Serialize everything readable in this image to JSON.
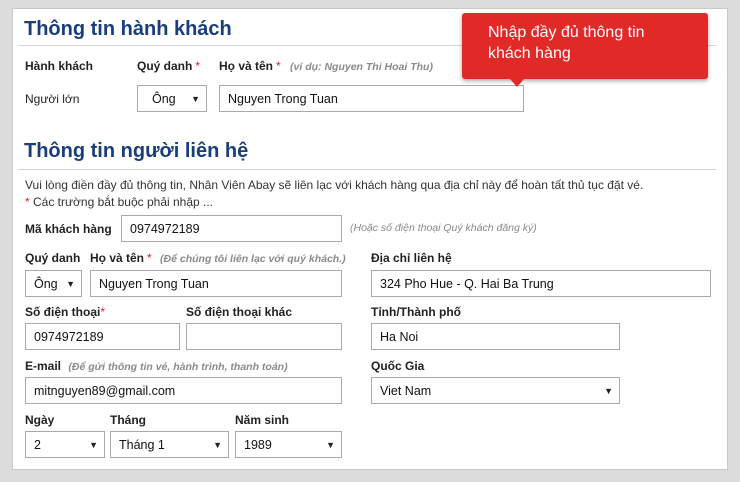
{
  "passenger": {
    "title": "Thông tin hành khách",
    "col_passenger": "Hành khách",
    "col_salutation": "Quý danh",
    "col_fullname": "Họ và tên",
    "required_mark": "*",
    "fullname_hint": "(ví dụ: Nguyen Thi Hoai Thu)",
    "type_label": "Người lớn",
    "salutation_value": "Ông",
    "fullname_value": "Nguyen Trong Tuan"
  },
  "tooltip": {
    "text_line1": "Nhập đầy đủ thông tin",
    "text_line2": "khách hàng"
  },
  "contact": {
    "title": "Thông tin người liên hệ",
    "info_line1": "Vui lòng điền đầy đủ thông tin, Nhân Viên Abay sẽ liên lạc với khách hàng qua địa chỉ này để hoàn tất thủ tục đặt vé.",
    "info_line2_mark": "*",
    "info_line2": " Các trường bắt buộc phải nhập ...",
    "customer_code_label": "Mã khách hàng",
    "customer_code_value": "0974972189",
    "customer_code_hint": "(Hoặc số điện thoại Quý khách đăng ký)",
    "salutation_label": "Quý danh",
    "salutation_value": "Ông",
    "fullname_label": "Họ và tên",
    "required_mark": "*",
    "fullname_hint": "(Để chúng tôi liên lạc với quý khách.)",
    "fullname_value": "Nguyen Trong Tuan",
    "address_label": "Địa chỉ liên hệ",
    "address_value": "324 Pho Hue - Q. Hai Ba Trung",
    "phone_label": "Số điện thoại",
    "phone_value": "0974972189",
    "other_phone_label": "Số điện thoại khác",
    "other_phone_value": "",
    "city_label": "Tỉnh/Thành phố",
    "city_value": "Ha Noi",
    "email_label": "E-mail",
    "email_hint": "(Để gửi thông tin vé, hành trình, thanh toán)",
    "email_value": "mitnguyen89@gmail.com",
    "country_label": "Quốc Gia",
    "country_value": "Viet Nam",
    "day_label": "Ngày",
    "day_value": "2",
    "month_label": "Tháng",
    "month_value": "Tháng 1",
    "year_label": "Năm sinh",
    "year_value": "1989"
  }
}
